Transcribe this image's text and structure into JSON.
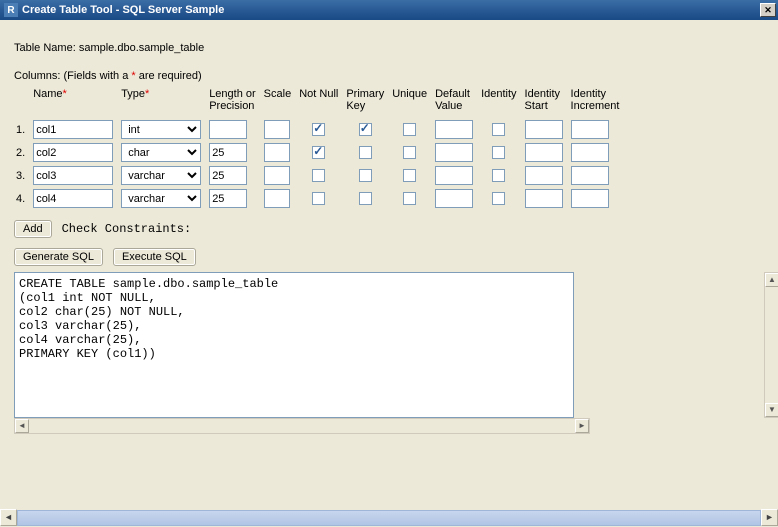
{
  "window": {
    "title": "Create Table Tool - SQL Server Sample",
    "icon_letter": "R"
  },
  "table_name_label": "Table Name:",
  "table_name": "sample.dbo.sample_table",
  "columns_label": "Columns: (Fields with a ",
  "columns_label_suffix": " are required)",
  "headers": {
    "name": "Name",
    "type": "Type",
    "length": "Length or\nPrecision",
    "scale": "Scale",
    "notnull": "Not Null",
    "pk": "Primary\nKey",
    "unique": "Unique",
    "default": "Default\nValue",
    "identity": "Identity",
    "idstart": "Identity\nStart",
    "idinc": "Identity\nIncrement"
  },
  "rows": [
    {
      "n": "1.",
      "name": "col1",
      "type": "int",
      "len": "",
      "scale": "",
      "notnull": true,
      "pk": true,
      "unique": false,
      "def": "",
      "identity": false,
      "idstart": "",
      "idinc": ""
    },
    {
      "n": "2.",
      "name": "col2",
      "type": "char",
      "len": "25",
      "scale": "",
      "notnull": true,
      "pk": false,
      "unique": false,
      "def": "",
      "identity": false,
      "idstart": "",
      "idinc": ""
    },
    {
      "n": "3.",
      "name": "col3",
      "type": "varchar",
      "len": "25",
      "scale": "",
      "notnull": false,
      "pk": false,
      "unique": false,
      "def": "",
      "identity": false,
      "idstart": "",
      "idinc": ""
    },
    {
      "n": "4.",
      "name": "col4",
      "type": "varchar",
      "len": "25",
      "scale": "",
      "notnull": false,
      "pk": false,
      "unique": false,
      "def": "",
      "identity": false,
      "idstart": "",
      "idinc": ""
    }
  ],
  "type_options": [
    "int",
    "char",
    "varchar"
  ],
  "buttons": {
    "add": "Add",
    "check_constraints": "Check Constraints:",
    "generate": "Generate SQL",
    "execute": "Execute SQL"
  },
  "sql": "CREATE TABLE sample.dbo.sample_table\n(col1 int NOT NULL,\ncol2 char(25) NOT NULL,\ncol3 varchar(25),\ncol4 varchar(25),\nPRIMARY KEY (col1))"
}
